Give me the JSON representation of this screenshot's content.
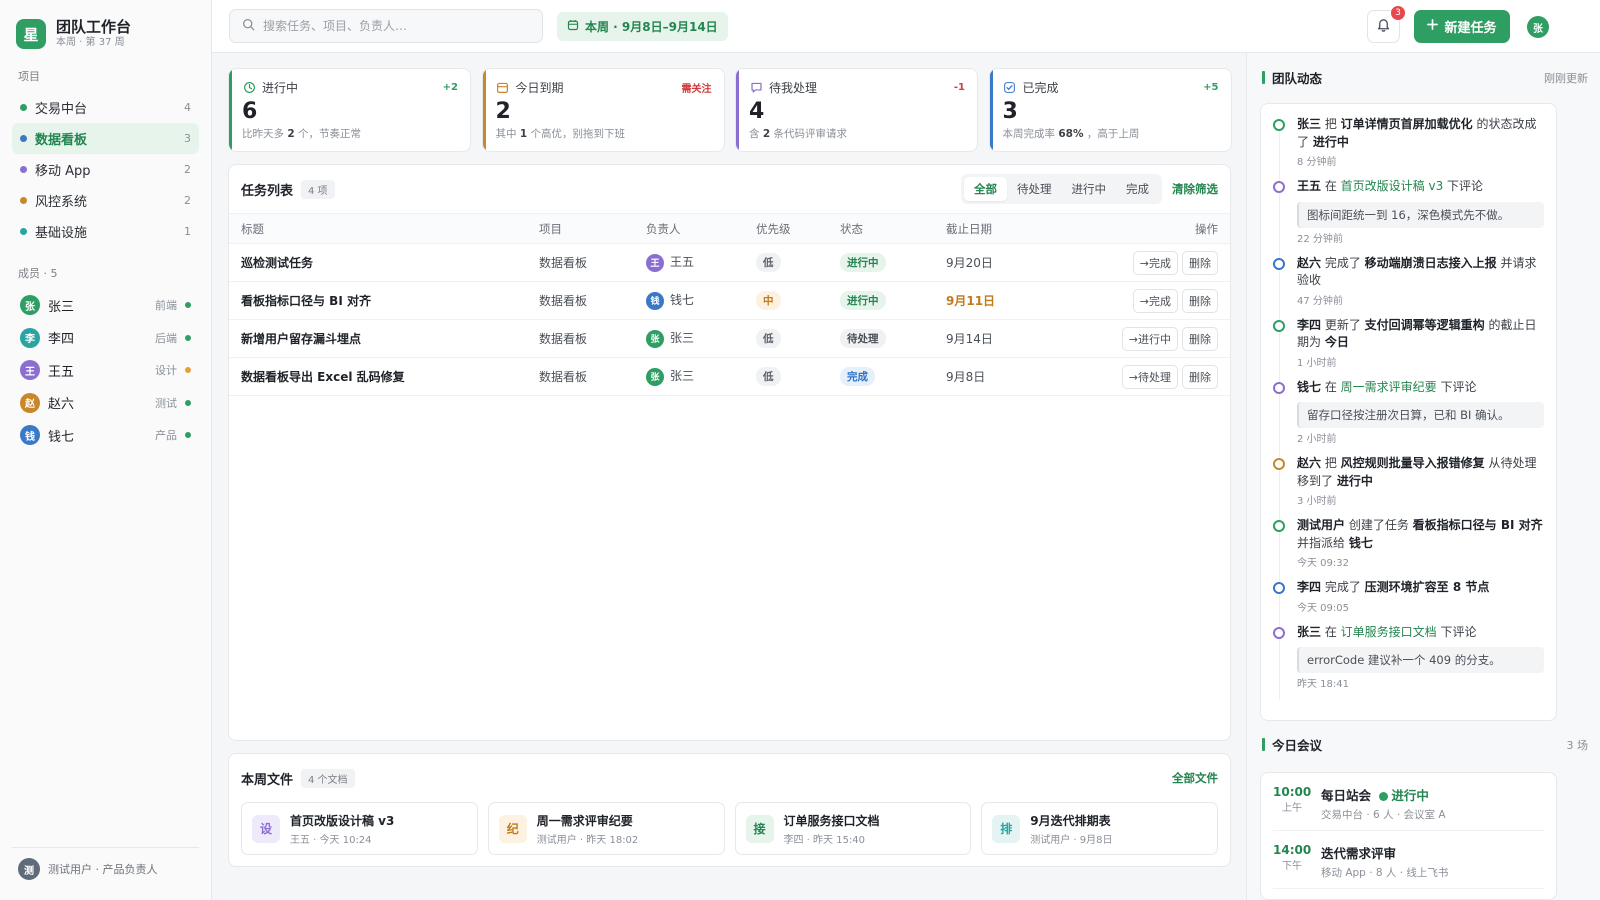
{
  "app": {
    "title": "团队工作台",
    "logo_char": "星",
    "subtitle": "本周 · 第 37 周"
  },
  "sidebar": {
    "projects_label": "项目",
    "projects": [
      {
        "name": "交易中台",
        "count": "4",
        "color": "#2e9e63",
        "active": false
      },
      {
        "name": "数据看板",
        "count": "3",
        "color": "#3a78c8",
        "active": true
      },
      {
        "name": "移动 App",
        "count": "2",
        "color": "#8a6fd1",
        "active": false
      },
      {
        "name": "风控系统",
        "count": "2",
        "color": "#c9862a",
        "active": false
      },
      {
        "name": "基础设施",
        "count": "1",
        "color": "#2ba3a0",
        "active": false
      }
    ],
    "members_label": "成员 · 5",
    "members": [
      {
        "initial": "张",
        "name": "张三",
        "role": "前端",
        "avatar_color": "#2e9e63",
        "status_color": "#2e9e63"
      },
      {
        "initial": "李",
        "name": "李四",
        "role": "后端",
        "avatar_color": "#2ba3a0",
        "status_color": "#2e9e63"
      },
      {
        "initial": "王",
        "name": "王五",
        "role": "设计",
        "avatar_color": "#8a6fd1",
        "status_color": "#e2a23b"
      },
      {
        "initial": "赵",
        "name": "赵六",
        "role": "测试",
        "avatar_color": "#c9862a",
        "status_color": "#2e9e63"
      },
      {
        "initial": "钱",
        "name": "钱七",
        "role": "产品",
        "avatar_color": "#3a78c8",
        "status_color": "#2e9e63"
      }
    ],
    "footer": {
      "initial": "测",
      "text": "测试用户 · 产品负责人"
    }
  },
  "topbar": {
    "search_placeholder": "搜索任务、项目、负责人…",
    "week_chip": "本周 · 9月8日–9月14日",
    "notifications": "3",
    "new_task": "新建任务",
    "user_initial": "张"
  },
  "stats": [
    {
      "icon": "clock-icon",
      "label": "进行中",
      "delta": "+2",
      "delta_color": "#2e9e63",
      "value": "6",
      "note_pre": "比昨天多",
      "note_b": "2",
      "note_post": "个，节奏正常",
      "color": "#2e9e63"
    },
    {
      "icon": "calendar-icon",
      "label": "今日到期",
      "delta": "需关注",
      "delta_color": "#d23b3b",
      "value": "2",
      "note_pre": "其中",
      "note_b": "1",
      "note_post": "个高优，别拖到下班",
      "color": "#c9862a"
    },
    {
      "icon": "chat-icon",
      "label": "待我处理",
      "delta": "-1",
      "delta_color": "#d23b3b",
      "value": "4",
      "note_pre": "含",
      "note_b": "2",
      "note_post": "条代码评审请求",
      "color": "#8a6fd1"
    },
    {
      "icon": "check-icon",
      "label": "已完成",
      "delta": "+5",
      "delta_color": "#2e9e63",
      "value": "3",
      "note_pre": "本周完成率",
      "note_b": "68%",
      "note_post": "，高于上周",
      "color": "#3a78c8"
    }
  ],
  "tasks": {
    "title": "任务列表",
    "count": "4 项",
    "filters": [
      "全部",
      "待处理",
      "进行中",
      "完成"
    ],
    "active_filter": 0,
    "clear": "清除筛选",
    "columns": [
      "标题",
      "项目",
      "负责人",
      "优先级",
      "状态",
      "截止日期",
      "操作"
    ],
    "rows": [
      {
        "title": "巡检测试任务",
        "project": "数据看板",
        "owner_initial": "王",
        "owner": "王五",
        "owner_color": "#8a6fd1",
        "priority": "低",
        "priority_kind": "low",
        "status": "进行中",
        "status_kind": "doing",
        "due": "9月20日",
        "due_hot": false,
        "action": "→完成",
        "delete": "删除"
      },
      {
        "title": "看板指标口径与 BI 对齐",
        "project": "数据看板",
        "owner_initial": "钱",
        "owner": "钱七",
        "owner_color": "#3a78c8",
        "priority": "中",
        "priority_kind": "mid",
        "status": "进行中",
        "status_kind": "doing",
        "due": "9月11日",
        "due_hot": true,
        "action": "→完成",
        "delete": "删除"
      },
      {
        "title": "新增用户留存漏斗埋点",
        "project": "数据看板",
        "owner_initial": "张",
        "owner": "张三",
        "owner_color": "#2e9e63",
        "priority": "低",
        "priority_kind": "low",
        "status": "待处理",
        "status_kind": "todo",
        "due": "9月14日",
        "due_hot": false,
        "action": "→进行中",
        "delete": "删除"
      },
      {
        "title": "数据看板导出 Excel 乱码修复",
        "project": "数据看板",
        "owner_initial": "张",
        "owner": "张三",
        "owner_color": "#2e9e63",
        "priority": "低",
        "priority_kind": "low",
        "status": "完成",
        "status_kind": "done",
        "due": "9月8日",
        "due_hot": false,
        "action": "→待处理",
        "delete": "删除"
      }
    ]
  },
  "files": {
    "title": "本周文件",
    "count": "4 个文档",
    "all": "全部文件",
    "items": [
      {
        "char": "设",
        "name": "首页改版设计稿 v3",
        "meta": "王五 · 今天 10:24",
        "bg": "#efeafb",
        "fg": "#8a6fd1"
      },
      {
        "char": "纪",
        "name": "周一需求评审纪要",
        "meta": "测试用户 · 昨天 18:02",
        "bg": "#fdf1e2",
        "fg": "#c27a1a"
      },
      {
        "char": "接",
        "name": "订单服务接口文档",
        "meta": "李四 · 昨天 15:40",
        "bg": "#e6f4ec",
        "fg": "#23854f"
      },
      {
        "char": "排",
        "name": "9月迭代排期表",
        "meta": "测试用户 · 9月8日",
        "bg": "#e3f4f3",
        "fg": "#2ba3a0"
      }
    ]
  },
  "feed": {
    "title": "团队动态",
    "updated": "刚刚更新",
    "events": [
      {
        "color": "#2e9e63",
        "parts": [
          [
            "b",
            "张三"
          ],
          [
            "t",
            " 把 "
          ],
          [
            "b",
            "订单详情页首屏加载优化"
          ],
          [
            "t",
            " 的状态改成了 "
          ],
          [
            "b",
            "进行中"
          ]
        ],
        "time": "8 分钟前"
      },
      {
        "color": "#8a6fd1",
        "parts": [
          [
            "b",
            "王五"
          ],
          [
            "t",
            " 在 "
          ],
          [
            "l",
            "首页改版设计稿 v3"
          ],
          [
            "t",
            " 下评论"
          ]
        ],
        "quote": "图标间距统一到 16，深色模式先不做。",
        "time": "22 分钟前"
      },
      {
        "color": "#3a78c8",
        "parts": [
          [
            "b",
            "赵六"
          ],
          [
            "t",
            " 完成了 "
          ],
          [
            "b",
            "移动端崩溃日志接入上报"
          ],
          [
            "t",
            " 并请求验收"
          ]
        ],
        "time": "47 分钟前"
      },
      {
        "color": "#2e9e63",
        "parts": [
          [
            "b",
            "李四"
          ],
          [
            "t",
            " 更新了 "
          ],
          [
            "b",
            "支付回调幂等逻辑重构"
          ],
          [
            "t",
            " 的截止日期为 "
          ],
          [
            "b",
            "今日"
          ]
        ],
        "time": "1 小时前"
      },
      {
        "color": "#8a6fd1",
        "parts": [
          [
            "b",
            "钱七"
          ],
          [
            "t",
            " 在 "
          ],
          [
            "l",
            "周一需求评审纪要"
          ],
          [
            "t",
            " 下评论"
          ]
        ],
        "quote": "留存口径按注册次日算，已和 BI 确认。",
        "time": "2 小时前"
      },
      {
        "color": "#c9862a",
        "parts": [
          [
            "b",
            "赵六"
          ],
          [
            "t",
            " 把 "
          ],
          [
            "b",
            "风控规则批量导入报错修复"
          ],
          [
            "t",
            " 从待处理移到了 "
          ],
          [
            "b",
            "进行中"
          ]
        ],
        "time": "3 小时前"
      },
      {
        "color": "#2e9e63",
        "parts": [
          [
            "b",
            "测试用户"
          ],
          [
            "t",
            " 创建了任务 "
          ],
          [
            "b",
            "看板指标口径与 BI 对齐"
          ],
          [
            "t",
            " 并指派给 "
          ],
          [
            "b",
            "钱七"
          ]
        ],
        "time": "今天 09:32"
      },
      {
        "color": "#3a78c8",
        "parts": [
          [
            "b",
            "李四"
          ],
          [
            "t",
            " 完成了 "
          ],
          [
            "b",
            "压测环境扩容至 8 节点"
          ]
        ],
        "time": "今天 09:05"
      },
      {
        "color": "#8a6fd1",
        "parts": [
          [
            "b",
            "张三"
          ],
          [
            "t",
            " 在 "
          ],
          [
            "l",
            "订单服务接口文档"
          ],
          [
            "t",
            " 下评论"
          ]
        ],
        "quote": "errorCode 建议补一个 409 的分支。",
        "time": "昨天 18:41"
      }
    ]
  },
  "meetings": {
    "title": "今日会议",
    "count": "3 场",
    "items": [
      {
        "time": "10:00",
        "ampm": "上午",
        "title": "每日站会",
        "live": "进行中",
        "meta": "交易中台 · 6 人 · 会议室 A"
      },
      {
        "time": "14:00",
        "ampm": "下午",
        "title": "迭代需求评审",
        "live": "",
        "meta": "移动 App · 8 人 · 线上飞书"
      }
    ]
  }
}
